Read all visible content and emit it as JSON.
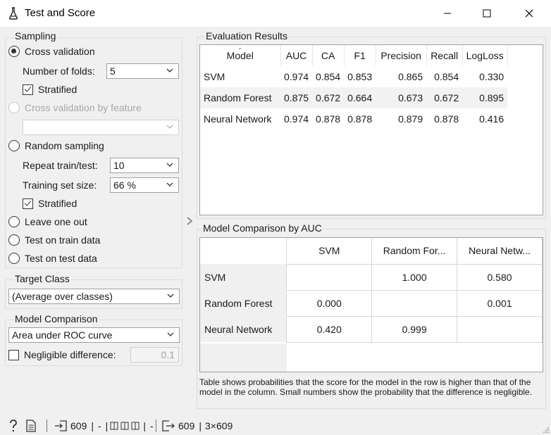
{
  "window": {
    "title": "Test and Score",
    "icon": "flask-icon",
    "controls": [
      "minimize-icon",
      "maximize-icon",
      "close-icon"
    ]
  },
  "sampling": {
    "title": "Sampling",
    "cross_validation": {
      "label": "Cross validation",
      "checked": true
    },
    "folds_label": "Number of folds:",
    "folds_value": "5",
    "stratified_1": {
      "label": "Stratified",
      "checked": true
    },
    "cv_by_feature": {
      "label": "Cross validation by feature",
      "disabled": true
    },
    "feature_value": "",
    "random_sampling": {
      "label": "Random sampling",
      "checked": false
    },
    "repeat_label": "Repeat train/test:",
    "repeat_value": "10",
    "train_size_label": "Training set size:",
    "train_size_value": "66 %",
    "stratified_2": {
      "label": "Stratified",
      "checked": true
    },
    "leave_one_out": {
      "label": "Leave one out",
      "checked": false
    },
    "test_on_train": {
      "label": "Test on train data",
      "checked": false
    },
    "test_on_test": {
      "label": "Test on test data",
      "checked": false
    }
  },
  "target_class": {
    "title": "Target Class",
    "value": "(Average over classes)"
  },
  "model_comparison": {
    "title": "Model Comparison",
    "value": "Area under ROC curve",
    "negligible_label": "Negligible difference:",
    "negligible_checked": false,
    "negligible_value": "0.1"
  },
  "evaluation": {
    "title": "Evaluation Results",
    "columns": [
      "Model",
      "AUC",
      "CA",
      "F1",
      "Precision",
      "Recall",
      "LogLoss"
    ],
    "rows": [
      [
        "SVM",
        "0.974",
        "0.854",
        "0.853",
        "0.865",
        "0.854",
        "0.330"
      ],
      [
        "Random Forest",
        "0.875",
        "0.672",
        "0.664",
        "0.673",
        "0.672",
        "0.895"
      ],
      [
        "Neural Network",
        "0.974",
        "0.878",
        "0.878",
        "0.879",
        "0.878",
        "0.416"
      ]
    ]
  },
  "comparison": {
    "title": "Model Comparison by AUC",
    "columns": [
      "SVM",
      "Random For...",
      "Neural Netw..."
    ],
    "rows": [
      {
        "name": "SVM",
        "cells": [
          "",
          "1.000",
          "0.580"
        ]
      },
      {
        "name": "Random Forest",
        "cells": [
          "0.000",
          "",
          "0.001"
        ]
      },
      {
        "name": "Neural Network",
        "cells": [
          "0.420",
          "0.999",
          ""
        ]
      }
    ],
    "footnote": "Table shows probabilities that the score for the model in the row is higher than that of the model in the column. Small numbers show the probability that the difference is negligible."
  },
  "statusbar": {
    "input_count": "609",
    "dash1": "-",
    "dash2": "-",
    "output_count": "609",
    "output_shape": "3×609"
  },
  "colors": {
    "background": "#f0f0f0",
    "border": "#a0a0a0",
    "alt_row": "#f2f2f2"
  }
}
